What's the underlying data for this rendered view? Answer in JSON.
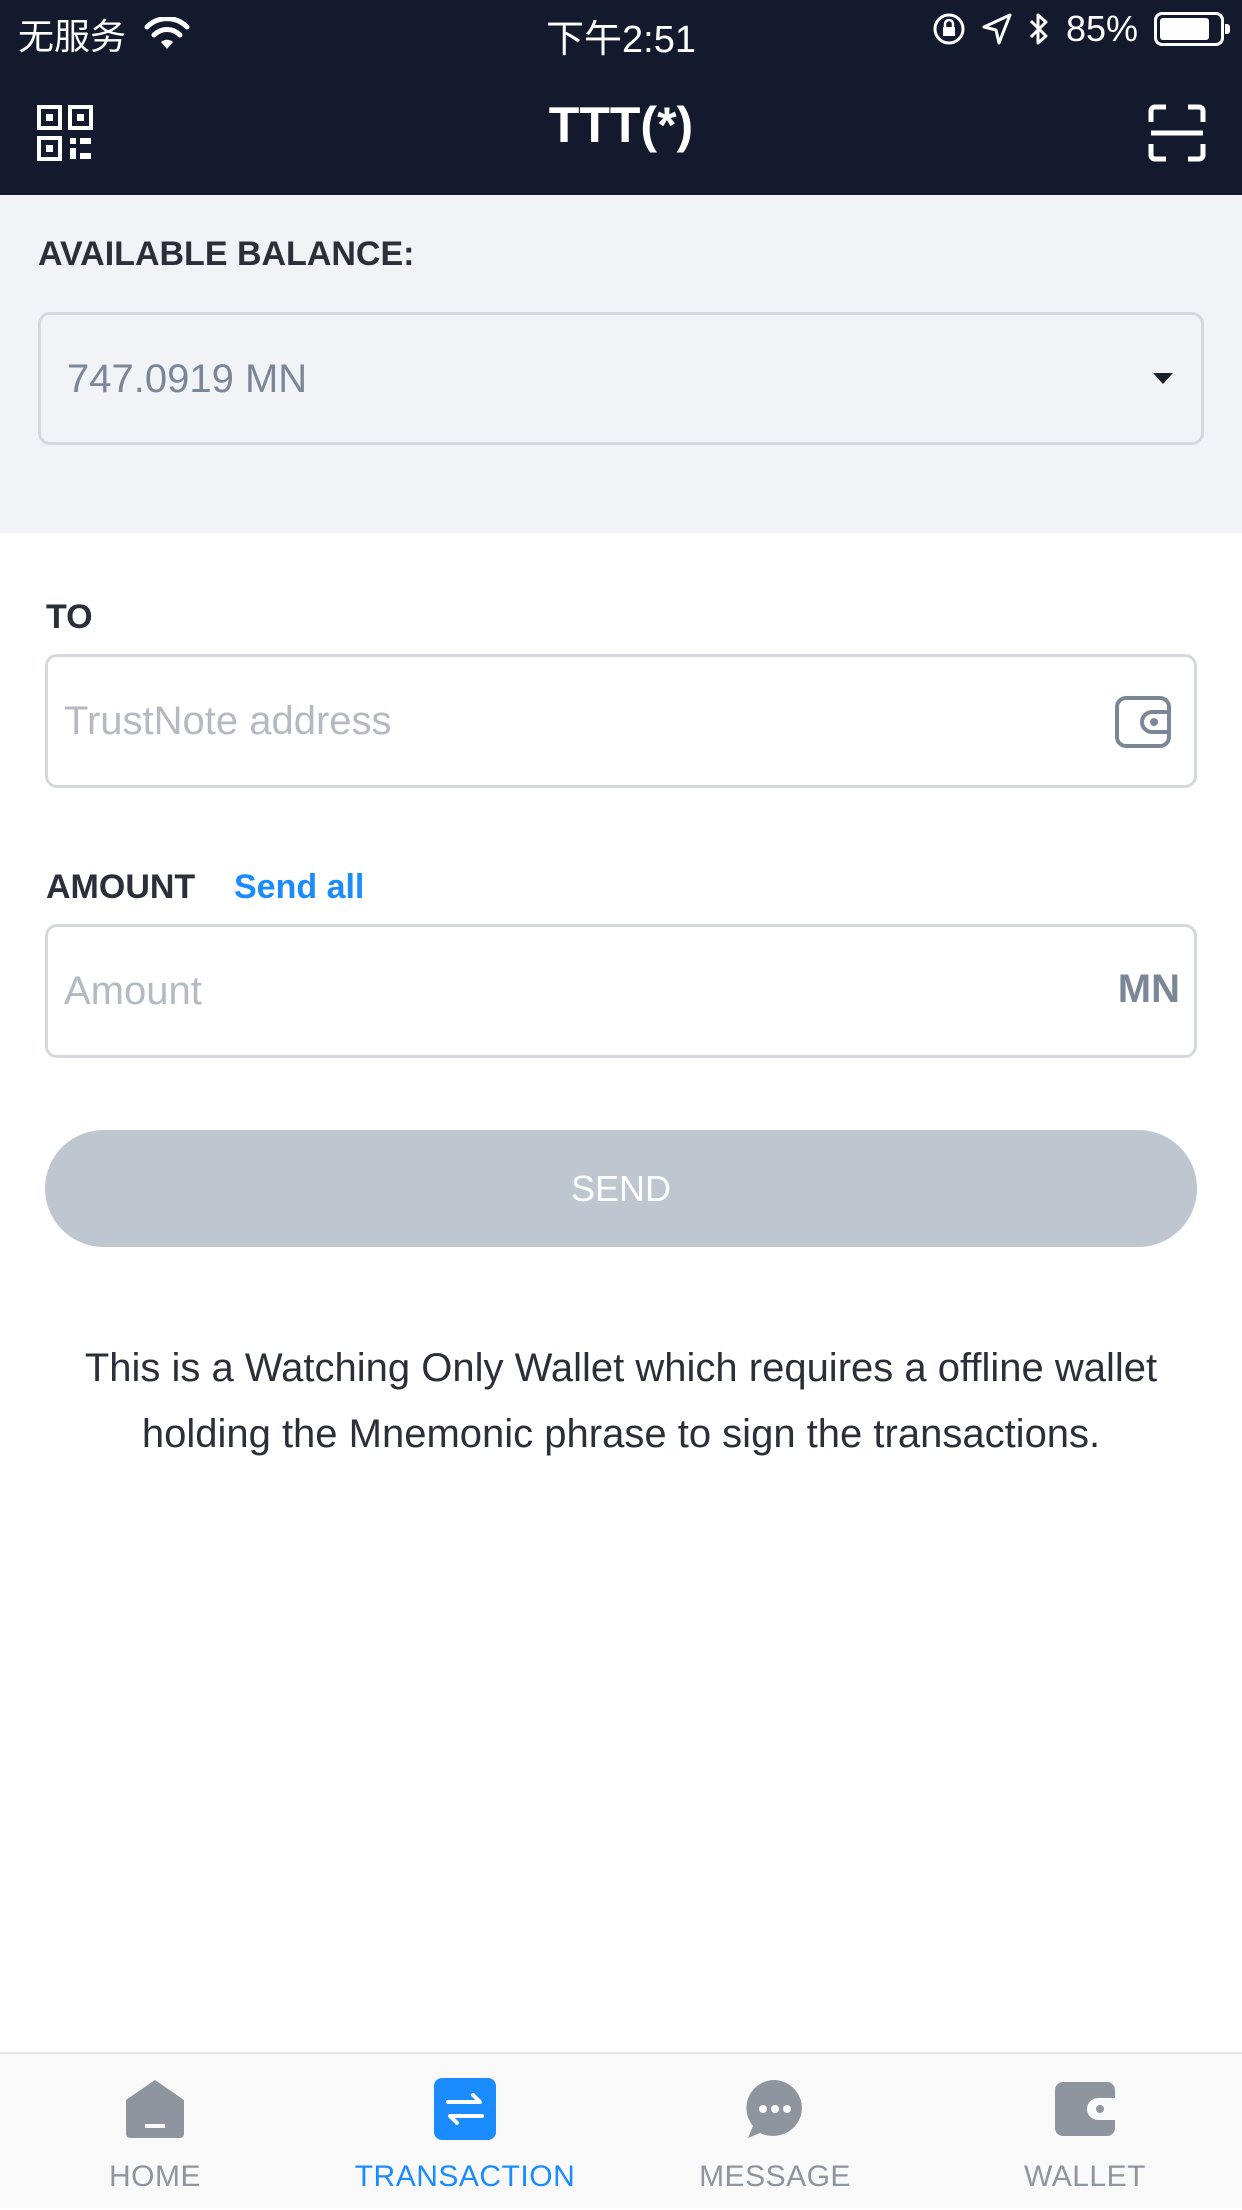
{
  "status_bar": {
    "carrier": "无服务",
    "time": "下午2:51",
    "battery": "85%",
    "battery_level": 0.85
  },
  "header": {
    "title": "TTT(*)",
    "left_icon": "qr-code-icon",
    "right_icon": "scan-icon"
  },
  "balance": {
    "label": "AVAILABLE BALANCE:",
    "value": "747.0919 MN"
  },
  "form": {
    "to_label": "TO",
    "to_placeholder": "TrustNote address",
    "to_value": "",
    "amount_label": "AMOUNT",
    "send_all": "Send all",
    "amount_placeholder": "Amount",
    "amount_value": "",
    "unit": "MN",
    "send_button": "SEND"
  },
  "note": "This is a Watching Only Wallet which requires a offline wallet holding the Mnemonic phrase to sign the transactions.",
  "tabs": [
    {
      "label": "HOME",
      "icon": "home-icon",
      "active": false
    },
    {
      "label": "TRANSACTION",
      "icon": "transaction-icon",
      "active": true
    },
    {
      "label": "MESSAGE",
      "icon": "message-icon",
      "active": false
    },
    {
      "label": "WALLET",
      "icon": "wallet-icon",
      "active": false
    }
  ],
  "colors": {
    "header_bg": "#141a2e",
    "accent": "#1a8cff",
    "disabled_button": "#bec6d0",
    "section_bg": "#f1f3f6"
  }
}
